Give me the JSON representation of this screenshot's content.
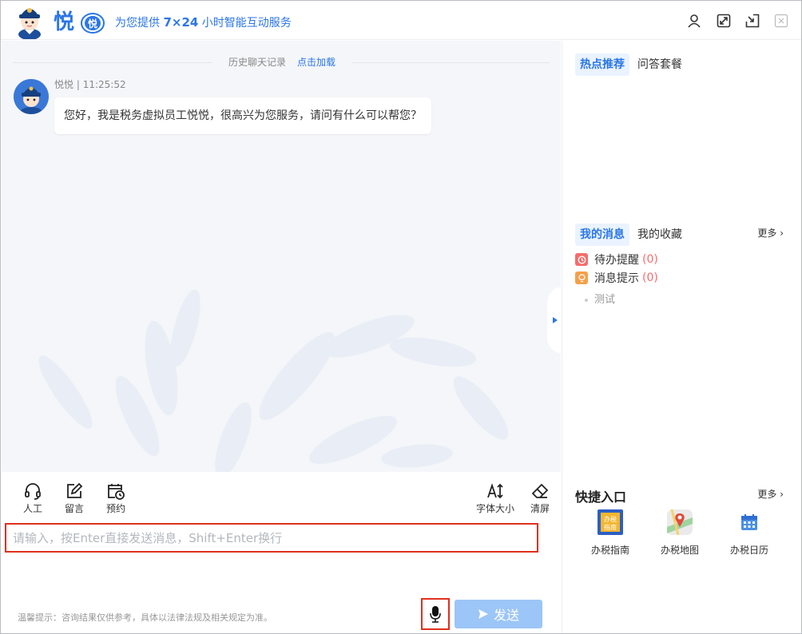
{
  "header": {
    "brand": "悦",
    "badge": "悦",
    "tagline_prefix": "为您提供",
    "tagline_emph": "7×24",
    "tagline_suffix": "小时智能互动服务",
    "icons": [
      "user-icon",
      "expand-icon",
      "exit-icon",
      "close-icon"
    ]
  },
  "chat": {
    "history_label": "历史聊天记录",
    "history_link": "点击加载",
    "messages": [
      {
        "sender": "悦悦",
        "time": "11:25:52",
        "text": "您好，我是税务虚拟员工悦悦，很高兴为您服务，请问有什么可以帮您？"
      }
    ]
  },
  "toolbar": {
    "left": [
      {
        "icon": "headset-icon",
        "label": "人工"
      },
      {
        "icon": "edit-icon",
        "label": "留言"
      },
      {
        "icon": "calendar-clock-icon",
        "label": "预约"
      }
    ],
    "right": [
      {
        "icon": "font-size-icon",
        "label": "字体大小"
      },
      {
        "icon": "eraser-icon",
        "label": "清屏"
      }
    ]
  },
  "input": {
    "placeholder": "请输入，按Enter直接发送消息，Shift+Enter换行",
    "value": ""
  },
  "hint": "温馨提示：咨询结果仅供参考，具体以法律法规及相关规定为准。",
  "send_label": "发送",
  "right_panel": {
    "top_tabs": [
      {
        "label": "热点推荐",
        "active": true
      },
      {
        "label": "问答套餐",
        "active": false
      }
    ],
    "msg_tabs": [
      {
        "label": "我的消息",
        "active": true
      },
      {
        "label": "我的收藏",
        "active": false
      }
    ],
    "more": "更多",
    "notices": [
      {
        "icon": "clock-icon",
        "color": "#f56c6c",
        "label": "待办提醒",
        "count": "(0)"
      },
      {
        "icon": "bulb-icon",
        "color": "#f5a04a",
        "label": "消息提示",
        "count": "(0)"
      }
    ],
    "sub_item": "测试",
    "quick_title": "快捷入口",
    "quick_more": "更多",
    "quick": [
      {
        "icon": "guide-icon",
        "label": "办税指南",
        "icon_text": "办税指南"
      },
      {
        "icon": "map-icon",
        "label": "办税地图"
      },
      {
        "icon": "calendar-icon",
        "label": "办税日历"
      }
    ]
  },
  "colors": {
    "brand": "#2b76e6",
    "highlight_border": "#e0301e",
    "send_bg": "#9cc6f7",
    "chat_bg": "#f4f6f9",
    "count_red": "#f56c6c"
  }
}
